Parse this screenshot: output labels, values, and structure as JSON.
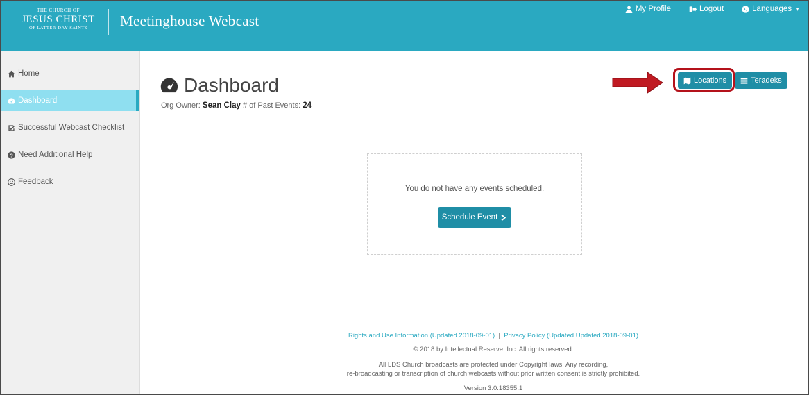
{
  "header": {
    "logo": {
      "line1": "THE CHURCH OF",
      "line2": "JESUS CHRIST",
      "line3": "OF LATTER-DAY SAINTS"
    },
    "app_title": "Meetinghouse Webcast",
    "nav": [
      {
        "label": "My Profile",
        "icon": "user-icon"
      },
      {
        "label": "Logout",
        "icon": "sign-out-icon"
      },
      {
        "label": "Languages",
        "icon": "globe-icon"
      }
    ]
  },
  "sidebar": {
    "items": [
      {
        "label": "Home",
        "icon": "home-icon",
        "active": false
      },
      {
        "label": "Dashboard",
        "icon": "dashboard-icon",
        "active": true
      },
      {
        "label": "Successful Webcast Checklist",
        "icon": "checkbox-icon",
        "active": false
      },
      {
        "label": "Need Additional Help",
        "icon": "question-circle-icon",
        "active": false
      },
      {
        "label": "Feedback",
        "icon": "smile-icon",
        "active": false
      }
    ]
  },
  "main": {
    "title": "Dashboard",
    "org_owner_label": "Org Owner:",
    "org_owner_value": "Sean Clay",
    "past_events_label": "# of Past Events:",
    "past_events_value": "24",
    "buttons": {
      "locations": "Locations",
      "teradeks": "Teradeks"
    },
    "empty_message": "You do not have any events scheduled.",
    "schedule_button": "Schedule Event"
  },
  "footer": {
    "rights_link": "Rights and Use Information (Updated 2018-09-01)",
    "separator": "|",
    "privacy_link": "Privacy Policy (Updated Updated 2018-09-01)",
    "copyright": "© 2018 by Intellectual Reserve, Inc. All rights reserved.",
    "notice_line1": "All LDS Church broadcasts are protected under Copyright laws. Any recording,",
    "notice_line2": "re-broadcasting or transcription of church webcasts without prior written consent is strictly prohibited.",
    "version": "Version 3.0.18355.1"
  },
  "colors": {
    "header": "#2aa9c1",
    "button": "#1f8ea6",
    "active_sidebar": "#8fdff0",
    "highlight": "#b4121b"
  }
}
